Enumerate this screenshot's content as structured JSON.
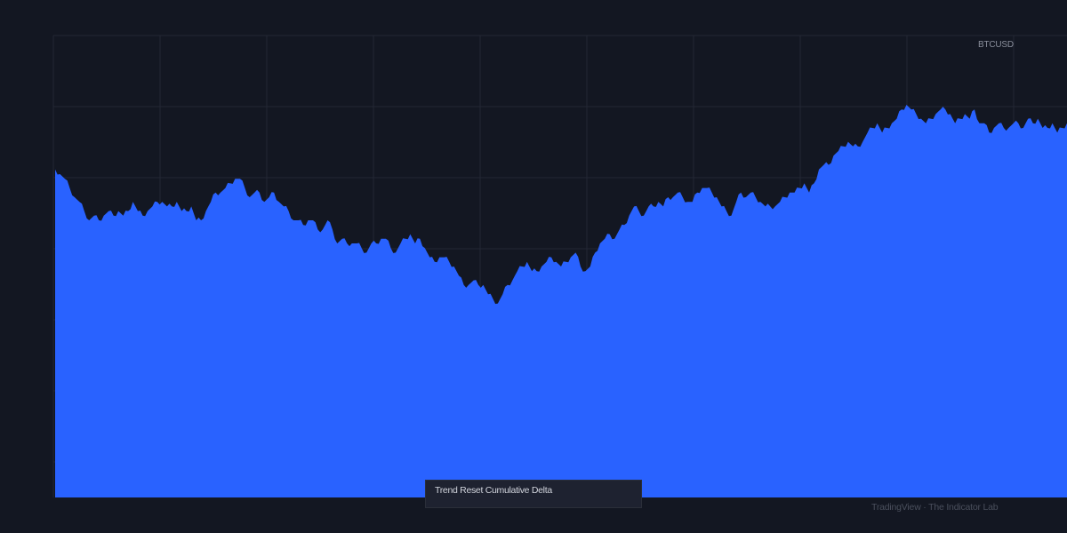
{
  "symbol": "BTCUSD",
  "indicator_label": "Trend Reset Cumulative Delta",
  "watermark": "TradingView · The Indicator Lab",
  "colors": {
    "background": "#131722",
    "grid": "#232734",
    "area_fill": "#2962ff"
  },
  "chart_data": {
    "type": "area",
    "title": "",
    "xlabel": "",
    "ylabel": "",
    "grid": true,
    "ylim": [
      0,
      100
    ],
    "x_gridlines": 10,
    "y_gridlines": 6,
    "series": [
      {
        "values": [
          71,
          70,
          69,
          67,
          65,
          64,
          62,
          60,
          61,
          60,
          61,
          62,
          61,
          62,
          61,
          62,
          64,
          62,
          61,
          62,
          63,
          64,
          64,
          63,
          63,
          64,
          62,
          62,
          63,
          60,
          60,
          62,
          64,
          66,
          66,
          67,
          68,
          69,
          69,
          67,
          65,
          66,
          66,
          64,
          65,
          66,
          64,
          63,
          62,
          60,
          60,
          59,
          60,
          60,
          58,
          58,
          60,
          58,
          55,
          56,
          55,
          55,
          55,
          54,
          53,
          55,
          55,
          56,
          56,
          54,
          53,
          55,
          56,
          57,
          55,
          56,
          54,
          52,
          51,
          52,
          52,
          51,
          50,
          48,
          46,
          46,
          47,
          46,
          46,
          44,
          43,
          42,
          44,
          46,
          47,
          49,
          50,
          51,
          49,
          49,
          50,
          51,
          52,
          51,
          50,
          51,
          52,
          53,
          50,
          49,
          50,
          53,
          55,
          56,
          57,
          56,
          58,
          59,
          61,
          63,
          62,
          61,
          63,
          63,
          64,
          63,
          65,
          65,
          66,
          65,
          64,
          64,
          66,
          67,
          67,
          66,
          65,
          63,
          62,
          61,
          64,
          66,
          65,
          66,
          65,
          64,
          63,
          63,
          63,
          64,
          65,
          66,
          66,
          67,
          68,
          66,
          68,
          71,
          72,
          72,
          74,
          75,
          76,
          77,
          76,
          76,
          77,
          79,
          80,
          81,
          79,
          80,
          81,
          82,
          84,
          85,
          84,
          83,
          82,
          81,
          82,
          83,
          84,
          84,
          83,
          81,
          82,
          83,
          82,
          84,
          81,
          81,
          79,
          80,
          81,
          80,
          80,
          81,
          81,
          80,
          82,
          81,
          82,
          80,
          80,
          81,
          79,
          80,
          81
        ]
      }
    ]
  }
}
